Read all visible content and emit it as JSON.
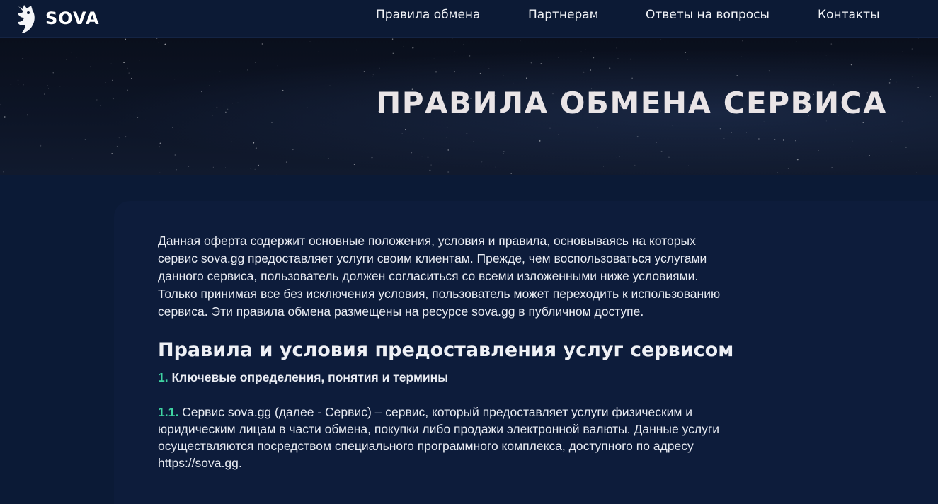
{
  "header": {
    "logo_text": "SOVA",
    "nav": [
      {
        "label": "Правила обмена"
      },
      {
        "label": "Партнерам"
      },
      {
        "label": "Ответы на вопросы"
      },
      {
        "label": "Контакты"
      }
    ]
  },
  "hero": {
    "title": "ПРАВИЛА ОБМЕНА СЕРВИСА"
  },
  "content": {
    "intro": "Данная оферта содержит основные положения, условия и правила, основываясь на которых сервис sova.gg предоставляет услуги своим клиентам. Прежде, чем воспользоваться услугами данного сервиса, пользователь должен согласиться со всеми изложенными ниже условиями. Только принимая все без исключения условия, пользователь может переходить к использованию сервиса. Эти правила обмена размещены на ресурсе sova.gg в публичном доступе.",
    "section_title": "Правила и условия предоставления услуг сервисом",
    "item1_number": "1.",
    "item1_title": "Ключевые определения, понятия и термины",
    "item11_number": "1.1.",
    "item11_text": "Сервис sova.gg (далее - Сервис) – сервис, который предоставляет услуги физическим и юридическим лицам в части обмена, покупки либо продажи электронной валюты. Данные услуги осуществляются посредством специального программного комплекса, доступного по адресу https://sova.gg."
  },
  "colors": {
    "header_bg": "#0c1a35",
    "page_bg": "#0b1730",
    "accent_number": "#3fd4a2"
  },
  "icons": {
    "logo": "owl-logo-icon"
  }
}
